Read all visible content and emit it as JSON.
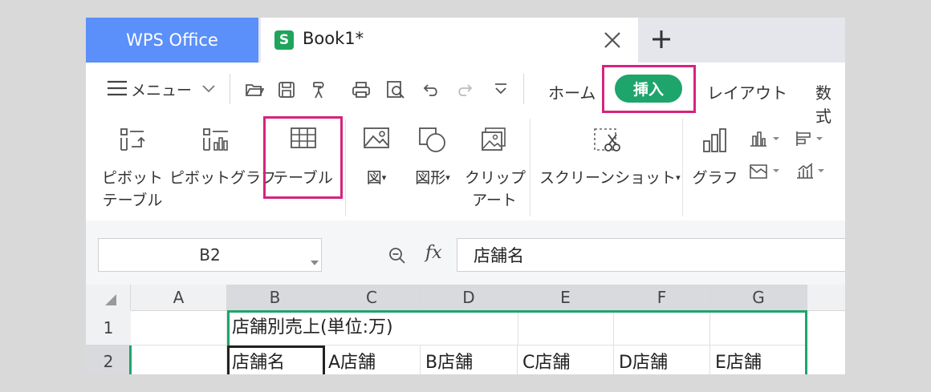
{
  "tabs": {
    "app_tab": "WPS Office",
    "doc_icon_letter": "S",
    "doc_title": "Book1*"
  },
  "toolbar": {
    "menu_label": "メニュー",
    "ribbon_tabs": [
      "ホーム",
      "挿入",
      "レイアウト",
      "数式"
    ]
  },
  "ribbon": {
    "pivot_table": [
      "ピボット",
      "テーブル"
    ],
    "pivot_chart": "ピボットグラフ",
    "table": "テーブル",
    "picture": "図",
    "shape": "図形",
    "clipart": [
      "クリップ",
      "アート"
    ],
    "screenshot": "スクリーンショット",
    "chart": "グラフ"
  },
  "formula_bar": {
    "name_box": "B2",
    "fx_label": "fx",
    "formula_value": "店舗名"
  },
  "sheet": {
    "columns": [
      "A",
      "B",
      "C",
      "D",
      "E",
      "F",
      "G"
    ],
    "rows": [
      "1",
      "2"
    ],
    "row1": {
      "B": "店舗別売上(単位:万)"
    },
    "row2": {
      "B": "店舗名",
      "C": "A店舗",
      "D": "B店舗",
      "E": "C店舗",
      "F": "D店舗",
      "G": "E店舗"
    }
  },
  "colors": {
    "app_tab_blue": "#5b8ff9",
    "accent_green": "#1ea56b",
    "highlight_magenta": "#d6237f"
  }
}
